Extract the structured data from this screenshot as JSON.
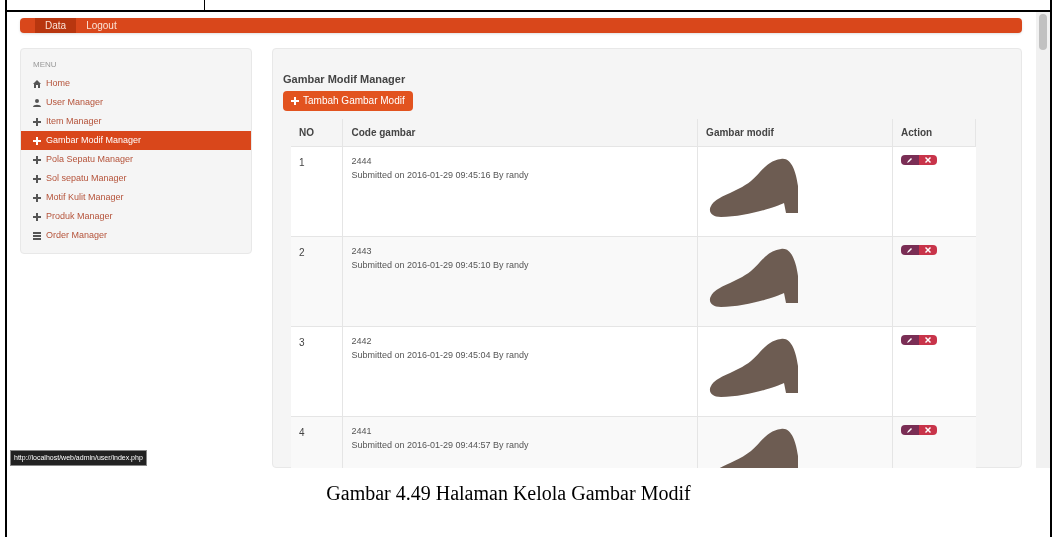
{
  "navbar": {
    "items": [
      {
        "label": "Data",
        "selected": true
      },
      {
        "label": "Logout",
        "selected": false
      }
    ]
  },
  "sidebar": {
    "heading": "MENU",
    "items": [
      {
        "label": "Home",
        "kind": "home",
        "selected": false
      },
      {
        "label": "User Manager",
        "kind": "user",
        "selected": false
      },
      {
        "label": "Item Manager",
        "kind": "plus",
        "selected": false
      },
      {
        "label": "Gambar Modif Manager",
        "kind": "plus",
        "selected": true
      },
      {
        "label": "Pola Sepatu Manager",
        "kind": "plus",
        "selected": false
      },
      {
        "label": "Sol sepatu Manager",
        "kind": "plus",
        "selected": false
      },
      {
        "label": "Motif Kulit Manager",
        "kind": "plus",
        "selected": false
      },
      {
        "label": "Produk Manager",
        "kind": "plus",
        "selected": false
      },
      {
        "label": "Order Manager",
        "kind": "grid",
        "selected": false
      }
    ]
  },
  "main": {
    "title": "Gambar Modif Manager",
    "add_button": "Tambah Gambar Modif",
    "table": {
      "columns": [
        "NO",
        "Code gambar",
        "Gambar modif",
        "Action"
      ],
      "rows": [
        {
          "no": "1",
          "code": "2444",
          "submitted": "Submitted on 2016-01-29 09:45:16 By randy"
        },
        {
          "no": "2",
          "code": "2443",
          "submitted": "Submitted on 2016-01-29 09:45:10 By randy"
        },
        {
          "no": "3",
          "code": "2442",
          "submitted": "Submitted on 2016-01-29 09:45:04 By randy"
        },
        {
          "no": "4",
          "code": "2441",
          "submitted": "Submitted on 2016-01-29 09:44:57 By randy"
        }
      ]
    }
  },
  "status_url": "http://localhost/web/admin/user/index.php",
  "document": {
    "caption": "Gambar 4.49 Halaman Kelola Gambar Modif"
  }
}
